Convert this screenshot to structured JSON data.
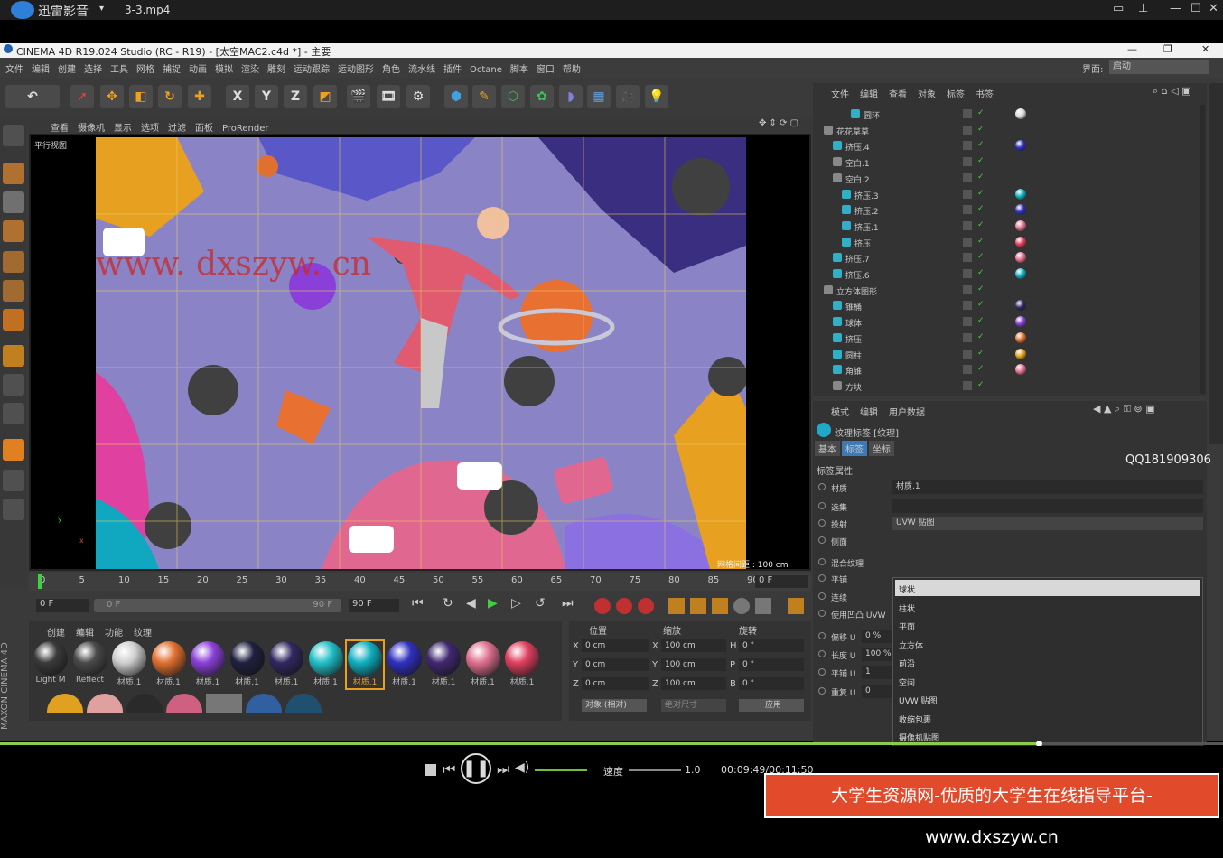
{
  "player": {
    "app_name": "迅雷影音",
    "file_name": "3-3.mp4",
    "speed_label": "速度",
    "speed_value": "1.0",
    "time": "00:09:49/00:11:50"
  },
  "c4d": {
    "window_title": "CINEMA 4D R19.024 Studio (RC - R19) - [太空MAC2.c4d *] - 主要",
    "menus": [
      "文件",
      "编辑",
      "创建",
      "选择",
      "工具",
      "网格",
      "捕捉",
      "动画",
      "模拟",
      "渲染",
      "雕刻",
      "运动跟踪",
      "运动图形",
      "角色",
      "流水线",
      "插件",
      "Octane",
      "脚本",
      "窗口",
      "帮助"
    ],
    "layout_label": "界面:",
    "layout_value": "启动",
    "viewport_menu": [
      "查看",
      "摄像机",
      "显示",
      "选项",
      "过滤",
      "面板",
      "ProRender"
    ],
    "viewport_name": "平行视图",
    "grid_info": "网格间距 : 100 cm",
    "axis_labels": [
      "y",
      "x"
    ],
    "xyz_buttons": [
      "X",
      "Y",
      "Z"
    ],
    "timeline": {
      "ticks": [
        "0",
        "5",
        "10",
        "15",
        "20",
        "25",
        "30",
        "35",
        "40",
        "45",
        "50",
        "55",
        "60",
        "65",
        "70",
        "75",
        "80",
        "85",
        "90"
      ],
      "current_frame": "0 F",
      "start": "0 F",
      "range_start": "0 F",
      "range_end": "90 F",
      "end": "90 F"
    },
    "material_manager": {
      "menus": [
        "创建",
        "编辑",
        "功能",
        "纹理"
      ],
      "materials": [
        {
          "label": "Light M",
          "color": "#3a3a3a"
        },
        {
          "label": "Reflect",
          "color": "#4a4a4a"
        },
        {
          "label": "材质.1",
          "color": "#d0d0d0"
        },
        {
          "label": "材质.1",
          "color": "#e07030"
        },
        {
          "label": "材质.1",
          "color": "#8a40d8"
        },
        {
          "label": "材质.1",
          "color": "#202040"
        },
        {
          "label": "材质.1",
          "color": "#302860"
        },
        {
          "label": "材质.1",
          "color": "#20c0c8"
        },
        {
          "label": "材质.1",
          "color": "#10b0c0"
        },
        {
          "label": "材质.1",
          "color": "#3030c0"
        },
        {
          "label": "材质.1",
          "color": "#402870"
        },
        {
          "label": "材质.1",
          "color": "#e07090"
        },
        {
          "label": "材质.1",
          "color": "#e04060"
        }
      ]
    },
    "coordinates": {
      "headers": [
        "位置",
        "缩放",
        "旋转"
      ],
      "rows": [
        {
          "axis": "X",
          "pos": "0 cm",
          "scale_axis": "X",
          "scale": "100 cm",
          "rot_axis": "H",
          "rot": "0 °"
        },
        {
          "axis": "Y",
          "pos": "0 cm",
          "scale_axis": "Y",
          "scale": "100 cm",
          "rot_axis": "P",
          "rot": "0 °"
        },
        {
          "axis": "Z",
          "pos": "0 cm",
          "scale_axis": "Z",
          "scale": "100 cm",
          "rot_axis": "B",
          "rot": "0 °"
        }
      ],
      "mode": "对象 (相对)",
      "size_mode": "绝对尺寸",
      "apply": "应用"
    },
    "object_manager": {
      "menus": [
        "文件",
        "编辑",
        "查看",
        "对象",
        "标签",
        "书签"
      ],
      "objects": [
        {
          "name": "圆环",
          "indent": 3,
          "tags": [
            "#d8d8d8"
          ]
        },
        {
          "name": "花花草草",
          "indent": 0,
          "tags": []
        },
        {
          "name": "挤压.4",
          "indent": 1,
          "tags": [
            "#3030c0"
          ]
        },
        {
          "name": "空白.1",
          "indent": 1,
          "tags": []
        },
        {
          "name": "空白.2",
          "indent": 1,
          "tags": []
        },
        {
          "name": "挤压.3",
          "indent": 2,
          "tags": [
            "#10b0c0"
          ]
        },
        {
          "name": "挤压.2",
          "indent": 2,
          "tags": [
            "#3030c0"
          ]
        },
        {
          "name": "挤压.1",
          "indent": 2,
          "tags": [
            "#e07090"
          ]
        },
        {
          "name": "挤压",
          "indent": 2,
          "tags": [
            "#e04060"
          ]
        },
        {
          "name": "挤压.7",
          "indent": 1,
          "tags": [
            "#e07090"
          ]
        },
        {
          "name": "挤压.6",
          "indent": 1,
          "tags": [
            "#10b0c0"
          ]
        },
        {
          "name": "立方体图形",
          "indent": 0,
          "tags": []
        },
        {
          "name": "锥桶",
          "indent": 1,
          "tags": [
            "#302860"
          ]
        },
        {
          "name": "球体",
          "indent": 1,
          "tags": [
            "#8a40d8"
          ]
        },
        {
          "name": "挤压",
          "indent": 1,
          "tags": [
            "#e07030"
          ]
        },
        {
          "name": "圆柱",
          "indent": 1,
          "tags": [
            "#e0a020"
          ]
        },
        {
          "name": "角锥",
          "indent": 1,
          "tags": [
            "#e07090"
          ]
        },
        {
          "name": "方块",
          "indent": 1,
          "tags": []
        }
      ]
    },
    "attributes": {
      "menus": [
        "模式",
        "编辑",
        "用户数据"
      ],
      "title": "纹理标签 [纹理]",
      "tabs": [
        "基本",
        "标签",
        "坐标"
      ],
      "section": "标签属性",
      "fields": [
        {
          "label": "材质",
          "value": "材质.1"
        },
        {
          "label": "选集",
          "value": ""
        },
        {
          "label": "投射",
          "value": "UVW 贴图"
        },
        {
          "label": "侧面",
          "value": ""
        },
        {
          "label": "混合纹理",
          "value": ""
        },
        {
          "label": "平铺",
          "value": ""
        },
        {
          "label": "连续",
          "value": ""
        },
        {
          "label": "使用凹凸 UVW",
          "value": ""
        },
        {
          "label": "偏移 U",
          "value": "0 %"
        },
        {
          "label": "长度 U",
          "value": "100 %"
        },
        {
          "label": "平铺 U",
          "value": "1"
        },
        {
          "label": "重复 U",
          "value": "0"
        }
      ],
      "projection_options": [
        "球状",
        "柱状",
        "平面",
        "立方体",
        "前沿",
        "空间",
        "UVW 贴图",
        "收缩包裹",
        "摄像机贴图"
      ],
      "qq": "QQ181909306"
    }
  },
  "watermark_url": "www. dxszyw. cn",
  "banner": "大学生资源网-优质的大学生在线指导平台-www.dxszyw.cn",
  "maxon_label": "MAXON CINEMA 4D"
}
